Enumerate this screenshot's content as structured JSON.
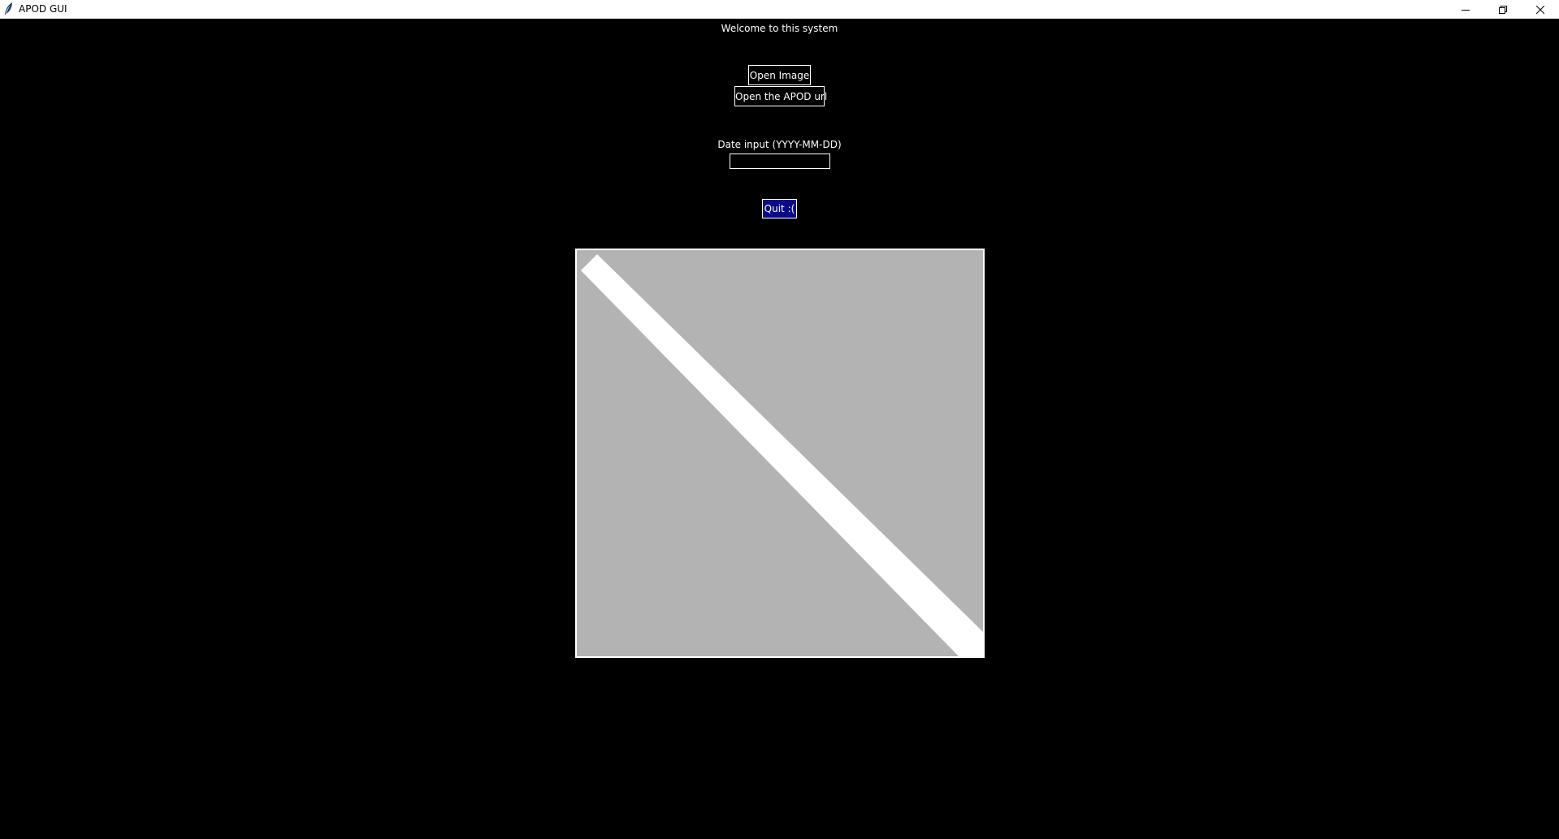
{
  "window": {
    "title": "APOD GUI",
    "icon": "feather-icon",
    "controls": {
      "minimize": "minimize-icon",
      "restore": "restore-icon",
      "close": "close-icon"
    }
  },
  "main": {
    "welcome_text": "Welcome to this system",
    "open_image_label": "Open Image",
    "open_url_label": "Open the APOD url",
    "date_label": "Date input (YYYY-MM-DD)",
    "date_value": "",
    "date_placeholder": "",
    "quit_label": "Quit :(",
    "image_placeholder_icon": "broken-image-placeholder-icon"
  },
  "colors": {
    "background": "#000000",
    "foreground": "#ffffff",
    "quit_button_bg": "#0a0a8a",
    "image_placeholder_bg": "#b3b3b3",
    "titlebar_bg": "#ffffff"
  }
}
